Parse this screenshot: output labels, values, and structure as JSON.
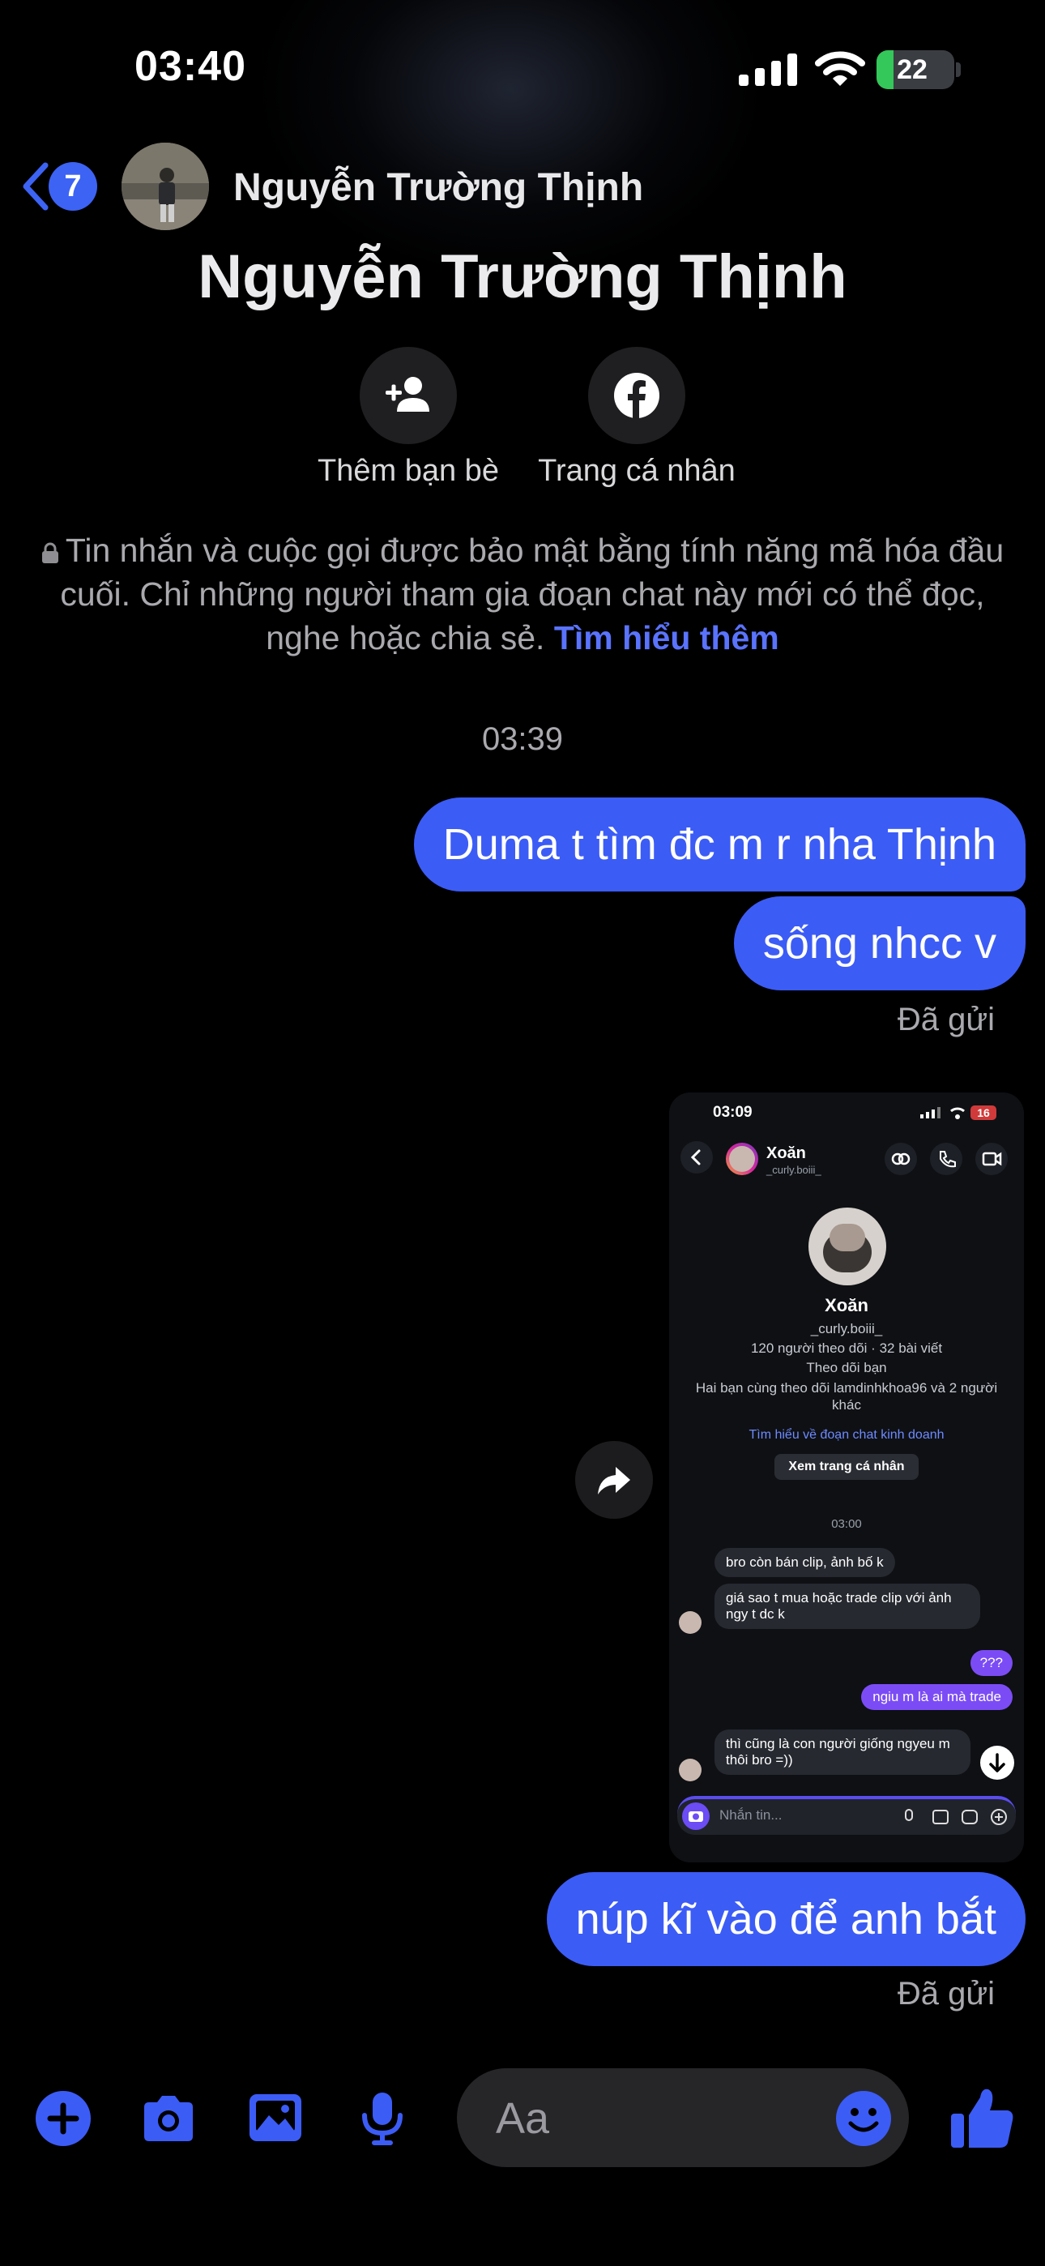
{
  "status_bar": {
    "time": "03:40",
    "battery": "22",
    "battery_level": 0.22
  },
  "header": {
    "back_badge": "7",
    "contact_name": "Nguyễn Trường Thịnh"
  },
  "profile": {
    "name": "Nguyễn Trường Thịnh",
    "actions": [
      {
        "label": "Thêm bạn bè",
        "icon": "add-person-icon"
      },
      {
        "label": "Trang cá nhân",
        "icon": "facebook-icon"
      }
    ],
    "encryption_notice": "Tin nhắn và cuộc gọi được bảo mật bằng tính năng mã hóa đầu cuối. Chỉ những người tham gia đoạn chat này mới có thể đọc, nghe hoặc chia sẻ.",
    "learn_more": "Tìm hiểu thêm"
  },
  "conversation": {
    "timestamp": "03:39",
    "messages": [
      {
        "text": "Duma t tìm đc m r nha Thịnh"
      },
      {
        "text": "sống nhcc v"
      },
      {
        "text": "núp kĩ vào để anh bắt"
      }
    ],
    "sent_label": "Đã gửi"
  },
  "shared_screenshot": {
    "time": "03:09",
    "battery": "16",
    "name": "Xoăn",
    "handle": "_curly.boiii_",
    "stats": "120 người theo dõi · 32 bài viết",
    "follows_you": "Theo dõi bạn",
    "mutual": "Hai bạn cùng theo dõi lamdinhkhoa96 và 2 người khác",
    "business_link": "Tìm hiểu về đoạn chat kinh doanh",
    "view_profile": "Xem trang cá nhân",
    "chat_time": "03:00",
    "msgs": [
      "bro còn bán clip, ảnh bố k",
      "giá sao t mua hoặc trade clip với ảnh ngy t dc k",
      "???",
      "ngiu m là ai mà trade",
      "thì cũng là con người giống ngyeu m thôi bro =))"
    ],
    "composer_placeholder": "Nhắn tin..."
  },
  "composer": {
    "placeholder": "Aa"
  },
  "colors": {
    "accent": "#3c5cf6",
    "link": "#5a73ff",
    "ig_purple": "#7b4cf5",
    "battery": "#34c759"
  }
}
